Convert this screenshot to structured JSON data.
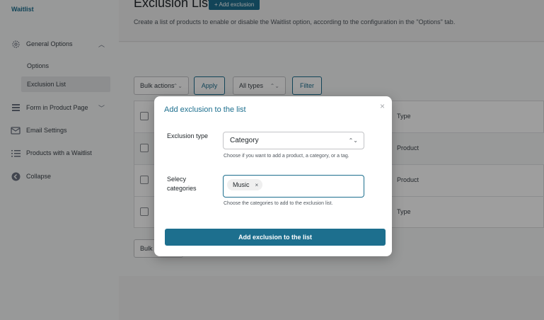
{
  "sidebar": {
    "brand": "Waitlist",
    "items": [
      {
        "label": "General Options",
        "icon": "gear-icon"
      },
      {
        "label": "Form in Product Page",
        "icon": "form-icon"
      },
      {
        "label": "Email Settings",
        "icon": "envelope-icon"
      },
      {
        "label": "Products with a Waitlist",
        "icon": "list-icon"
      },
      {
        "label": "Collapse",
        "icon": "collapse-icon"
      }
    ],
    "subitems": [
      "Options",
      "Exclusion List"
    ]
  },
  "page": {
    "title": "Exclusion List",
    "add_button": "+ Add exclusion",
    "description": "Create a list of products to enable or disable the Waitlist option, according to the configuration in the \"Options\" tab."
  },
  "toolbar": {
    "bulk_actions": "Bulk actions",
    "apply": "Apply",
    "types": "All types",
    "filter": "Filter",
    "bulk_bottom": "Bulk"
  },
  "table": {
    "rows": [
      {
        "type": "Type"
      },
      {
        "type": "Product"
      },
      {
        "type": "Product"
      },
      {
        "type": "Type"
      }
    ]
  },
  "modal": {
    "title": "Add exclusion to the list",
    "close": "×",
    "exclusion_type_label": "Exclusion type",
    "exclusion_type_value": "Category",
    "exclusion_type_hint": "Choose if you want to add a product, a category, or a tag.",
    "categories_label_1": "Selecy",
    "categories_label_2": "categories",
    "selected_tag": "Music",
    "tag_remove": "×",
    "categories_hint": "Choose the categories to add to the exclusion list.",
    "submit": "Add exclusion to the list"
  },
  "colors": {
    "accent": "#1d6f8e"
  }
}
